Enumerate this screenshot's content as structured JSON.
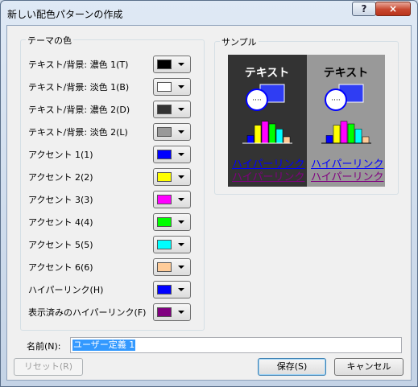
{
  "window": {
    "title": "新しい配色パターンの作成",
    "help_glyph": "?",
    "close_glyph": "×"
  },
  "theme_colors": {
    "group_title": "テーマの色",
    "rows": [
      {
        "label": "テキスト/背景: 濃色 1(T)",
        "color": "#000000"
      },
      {
        "label": "テキスト/背景: 淡色 1(B)",
        "color": "#ffffff"
      },
      {
        "label": "テキスト/背景: 濃色 2(D)",
        "color": "#333333"
      },
      {
        "label": "テキスト/背景: 淡色 2(L)",
        "color": "#999999"
      },
      {
        "label": "アクセント 1(1)",
        "color": "#0000ff"
      },
      {
        "label": "アクセント 2(2)",
        "color": "#ffff00"
      },
      {
        "label": "アクセント 3(3)",
        "color": "#ff00ff"
      },
      {
        "label": "アクセント 4(4)",
        "color": "#00ff00"
      },
      {
        "label": "アクセント 5(5)",
        "color": "#00ffff"
      },
      {
        "label": "アクセント 6(6)",
        "color": "#ffcc99"
      },
      {
        "label": "ハイパーリンク(H)",
        "color": "#0000ff"
      },
      {
        "label": "表示済みのハイパーリンク(F)",
        "color": "#800080"
      }
    ]
  },
  "sample": {
    "group_title": "サンプル",
    "text": "テキスト",
    "hyperlink": "ハイパーリンク",
    "followed_hyperlink": "ハイパーリンク",
    "dark_bg": "#333333",
    "light_bg": "#999999",
    "bar_colors": [
      "#0000ff",
      "#ffff00",
      "#ff00ff",
      "#00ff00",
      "#00ffff",
      "#ffcc99"
    ],
    "bar_levels": [
      0.3,
      0.7,
      0.85,
      0.75,
      0.55,
      0.25
    ]
  },
  "name": {
    "label": "名前(N):",
    "value": "ユーザー定義 1"
  },
  "buttons": {
    "reset": "リセット(R)",
    "save": "保存(S)",
    "cancel": "キャンセル"
  }
}
